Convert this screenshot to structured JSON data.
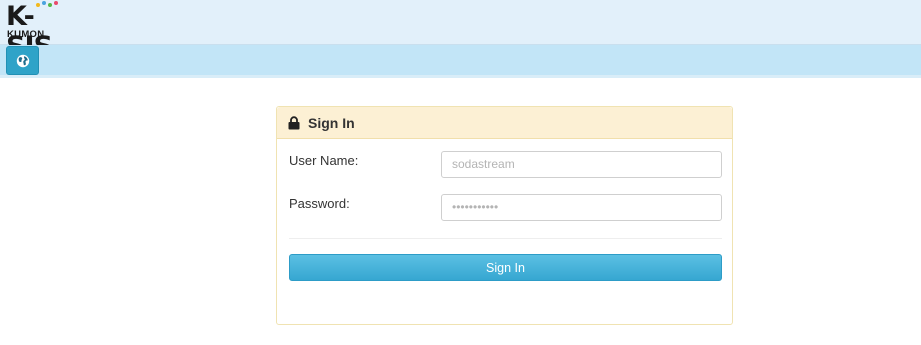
{
  "logo": {
    "brand": "K-SIS",
    "sub": "KUMON"
  },
  "nav": {
    "globe_icon": "globe-icon"
  },
  "signin_panel": {
    "icon": "lock-icon",
    "title": "Sign In",
    "username_label": "User Name:",
    "username_value": "sodastream",
    "password_label": "Password:",
    "password_value": "•••••••••••",
    "submit_label": "Sign In"
  },
  "colors": {
    "topbar": "#e2f0fa",
    "navbar": "#c2e5f7",
    "globe_button": "#2fa3c8",
    "panel_header": "#fcf0d4",
    "primary_button": "#3fb0d9"
  }
}
